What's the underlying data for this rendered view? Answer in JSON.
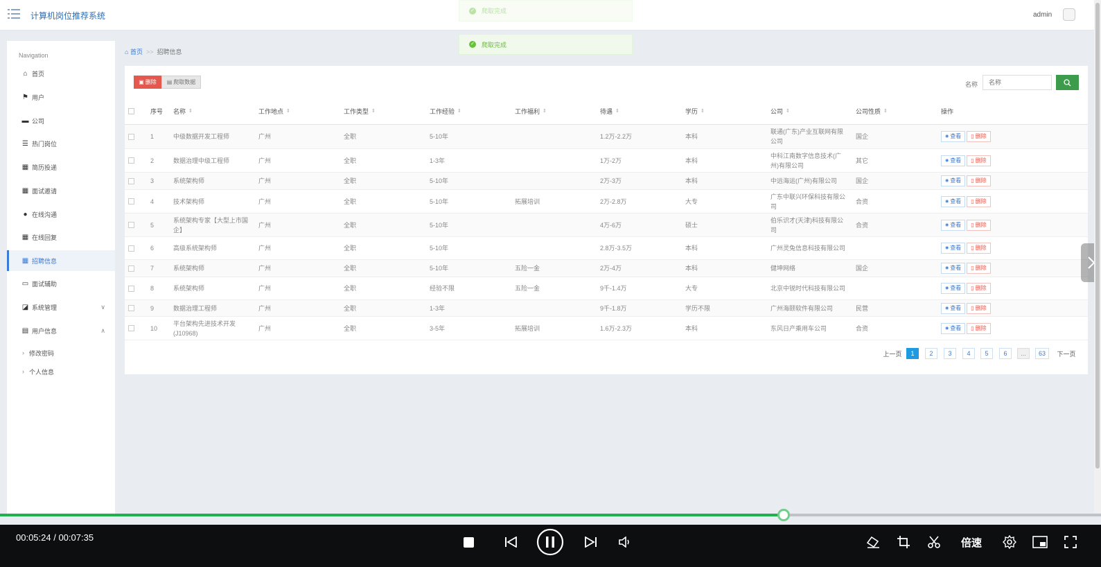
{
  "header": {
    "title": "计算机岗位推荐系统",
    "user": "admin"
  },
  "toasts": {
    "faded": "爬取完成",
    "main": "爬取完成"
  },
  "sidebar": {
    "title": "Navigation",
    "items": [
      {
        "label": "首页",
        "icon": "home-icon",
        "glyph": "⌂"
      },
      {
        "label": "用户",
        "icon": "flag-icon",
        "glyph": "⚑"
      },
      {
        "label": "公司",
        "icon": "briefcase-icon",
        "glyph": "▬"
      },
      {
        "label": "热门岗位",
        "icon": "list-icon",
        "glyph": "☰"
      },
      {
        "label": "简历投递",
        "icon": "grid-icon",
        "glyph": "▦"
      },
      {
        "label": "面试邀请",
        "icon": "grid-icon",
        "glyph": "▦"
      },
      {
        "label": "在线沟通",
        "icon": "pin-icon",
        "glyph": "●"
      },
      {
        "label": "在线回复",
        "icon": "grid-icon",
        "glyph": "▦"
      },
      {
        "label": "招聘信息",
        "icon": "grid-icon",
        "glyph": "▦",
        "active": true
      },
      {
        "label": "面试辅助",
        "icon": "comment-icon",
        "glyph": "▭"
      },
      {
        "label": "系统管理",
        "icon": "chart-icon",
        "glyph": "◪",
        "arrow": "∨"
      },
      {
        "label": "用户信息",
        "icon": "card-icon",
        "glyph": "▤",
        "arrow": "∧"
      }
    ],
    "sub_items": [
      "修改密码",
      "个人信息"
    ]
  },
  "breadcrumb": {
    "home": "首页",
    "sep": ">>",
    "current": "招聘信息"
  },
  "toolbar": {
    "delete_label": "删除",
    "crawl_label": "爬取数据",
    "search_label": "名称",
    "search_placeholder": "名称"
  },
  "table": {
    "columns": [
      "序号",
      "名称",
      "工作地点",
      "工作类型",
      "工作经验",
      "工作福利",
      "待遇",
      "学历",
      "公司",
      "公司性质",
      "操作"
    ],
    "view_label": "查看",
    "delete_label": "删除",
    "rows": [
      [
        "1",
        "中级数据开发工程师",
        "广州",
        "全职",
        "5-10年",
        "",
        "1.2万-2.2万",
        "本科",
        "联通(广东)产业互联网有限公司",
        "国企"
      ],
      [
        "2",
        "数据治理中级工程师",
        "广州",
        "全职",
        "1-3年",
        "",
        "1万-2万",
        "本科",
        "中科江南数字信息技术(广州)有限公司",
        "其它"
      ],
      [
        "3",
        "系统架构师",
        "广州",
        "全职",
        "5-10年",
        "",
        "2万-3万",
        "本科",
        "中远海运(广州)有限公司",
        "国企"
      ],
      [
        "4",
        "技术架构师",
        "广州",
        "全职",
        "5-10年",
        "拓展培训",
        "2万-2.8万",
        "大专",
        "广东中联兴环保科技有限公司",
        "合资"
      ],
      [
        "5",
        "系统架构专家【大型上市国企】",
        "广州",
        "全职",
        "5-10年",
        "",
        "4万-6万",
        "硕士",
        "伯乐识才(天津)科技有限公司",
        "合资"
      ],
      [
        "6",
        "高级系统架构师",
        "广州",
        "全职",
        "5-10年",
        "",
        "2.8万-3.5万",
        "本科",
        "广州灵兔信息科技有限公司",
        ""
      ],
      [
        "7",
        "系统架构师",
        "广州",
        "全职",
        "5-10年",
        "五险一金",
        "2万-4万",
        "本科",
        "健坤网络",
        "国企"
      ],
      [
        "8",
        "系统架构师",
        "广州",
        "全职",
        "经验不限",
        "五险一金",
        "9千-1.4万",
        "大专",
        "北京中锐时代科技有限公司",
        ""
      ],
      [
        "9",
        "数据治理工程师",
        "广州",
        "全职",
        "1-3年",
        "",
        "9千-1.8万",
        "学历不限",
        "广州海颐软件有限公司",
        "民营"
      ],
      [
        "10",
        "平台架构先进技术开发(J10968)",
        "广州",
        "全职",
        "3-5年",
        "拓展培训",
        "1.6万-2.3万",
        "本科",
        "东风日产乘用车公司",
        "合资"
      ]
    ]
  },
  "pagination": {
    "prev": "上一页",
    "pages": [
      "1",
      "2",
      "3",
      "4",
      "5",
      "6"
    ],
    "dots": "...",
    "last": "63",
    "next": "下一页",
    "current": "1"
  },
  "player": {
    "time": "00:05:24 / 00:07:35",
    "progress": 0.712,
    "speed_label": "倍速"
  }
}
